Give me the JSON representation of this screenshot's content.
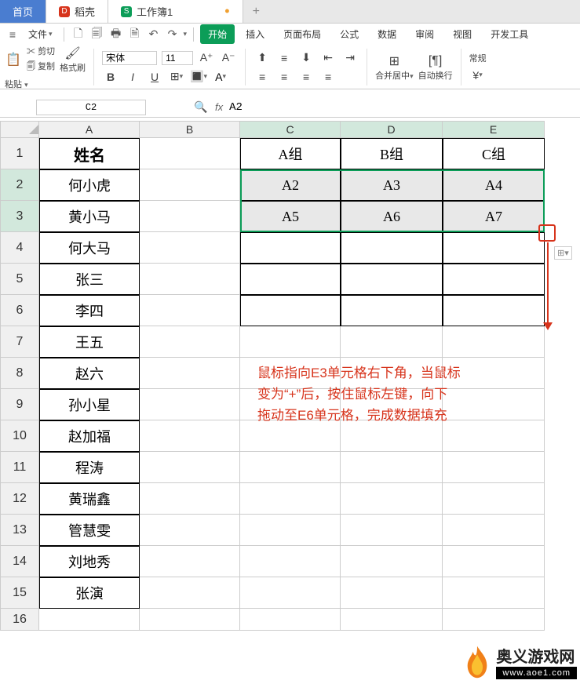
{
  "tabs": {
    "home": "首页",
    "daoke": "稻壳",
    "doc": "工作簿1"
  },
  "menu": {
    "file": "文件"
  },
  "ribbon": {
    "start": "开始",
    "insert": "插入",
    "layout": "页面布局",
    "formula": "公式",
    "data": "数据",
    "review": "审阅",
    "view": "视图",
    "dev": "开发工具"
  },
  "toolbar": {
    "cut": "剪切",
    "copy": "复制",
    "paste": "粘贴",
    "brush": "格式刷",
    "merge": "合并居中",
    "wrap": "自动换行",
    "general": "常规"
  },
  "font": {
    "name": "宋体",
    "size": "11"
  },
  "cellref": "C2",
  "formula": "A2",
  "columns": [
    "A",
    "B",
    "C",
    "D",
    "E"
  ],
  "rows": [
    "1",
    "2",
    "3",
    "4",
    "5",
    "6",
    "7",
    "8",
    "9",
    "10",
    "11",
    "12",
    "13",
    "14",
    "15",
    "16"
  ],
  "colA_header": "姓名",
  "colA_data": [
    "何小虎",
    "黄小马",
    "何大马",
    "张三",
    "李四",
    "王五",
    "赵六",
    "孙小星",
    "赵加福",
    "程涛",
    "黄瑞鑫",
    "管慧雯",
    "刘地秀",
    "张演"
  ],
  "groups_header": [
    "A组",
    "B组",
    "C组"
  ],
  "filled": [
    [
      "A2",
      "A3",
      "A4"
    ],
    [
      "A5",
      "A6",
      "A7"
    ]
  ],
  "annotation": {
    "l1": "鼠标指向E3单元格右下角，当鼠标",
    "l2": "变为“+”后，按住鼠标左键，向下",
    "l3": "拖动至E6单元格，完成数据填充"
  },
  "watermark": {
    "name": "奥义游戏网",
    "url": "www.aoe1.com"
  }
}
